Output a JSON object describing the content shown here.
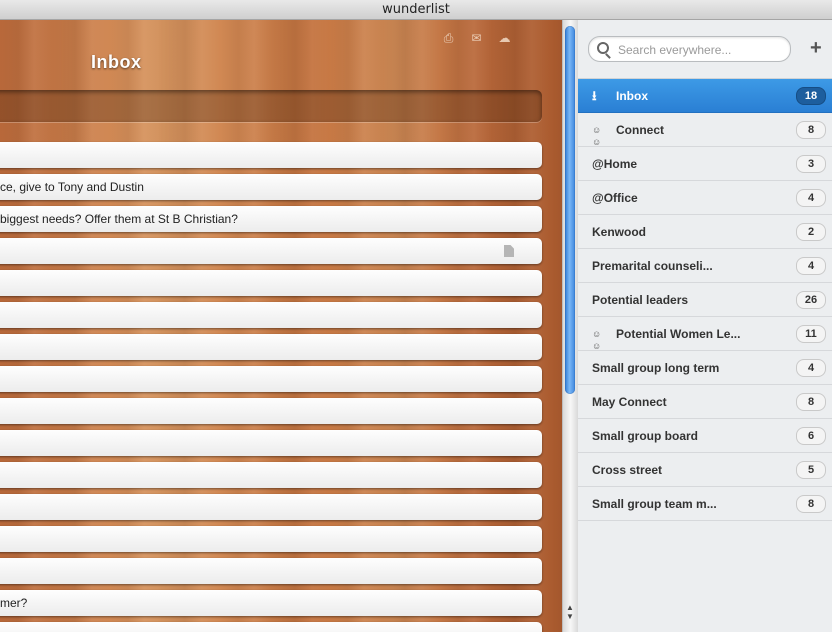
{
  "window": {
    "title": "wunderlist"
  },
  "main": {
    "title": "Inbox",
    "toolbar_icons": [
      "print-icon",
      "mail-icon",
      "cloud-icon"
    ],
    "tasks": [
      {
        "text": ""
      },
      {
        "text": "ce, give to Tony and Dustin"
      },
      {
        "text": "biggest needs? Offer them at St B Christian?"
      },
      {
        "text": "",
        "has_note": true
      },
      {
        "text": ""
      },
      {
        "text": ""
      },
      {
        "text": ""
      },
      {
        "text": ""
      },
      {
        "text": ""
      },
      {
        "text": ""
      },
      {
        "text": ""
      },
      {
        "text": ""
      },
      {
        "text": ""
      },
      {
        "text": ""
      },
      {
        "text": "mer?"
      },
      {
        "text": ""
      }
    ]
  },
  "sidebar": {
    "search": {
      "placeholder": "Search everywhere..."
    },
    "lists": [
      {
        "label": "Inbox",
        "count": "18",
        "icon": "inbox-icon",
        "active": true
      },
      {
        "label": "Connect",
        "count": "8",
        "icon": "shared-users-icon"
      },
      {
        "label": "@Home",
        "count": "3"
      },
      {
        "label": "@Office",
        "count": "4"
      },
      {
        "label": "Kenwood",
        "count": "2"
      },
      {
        "label": "Premarital counseli...",
        "count": "4"
      },
      {
        "label": "Potential leaders",
        "count": "26"
      },
      {
        "label": "Potential Women Le...",
        "count": "11",
        "icon": "shared-users-icon"
      },
      {
        "label": "Small group long term",
        "count": "4"
      },
      {
        "label": "May Connect",
        "count": "8"
      },
      {
        "label": "Small group board",
        "count": "6"
      },
      {
        "label": "Cross street",
        "count": "5"
      },
      {
        "label": "Small group team m...",
        "count": "8"
      }
    ]
  },
  "colors": {
    "accent": "#2a7fd4",
    "wood": "#c97b48"
  }
}
